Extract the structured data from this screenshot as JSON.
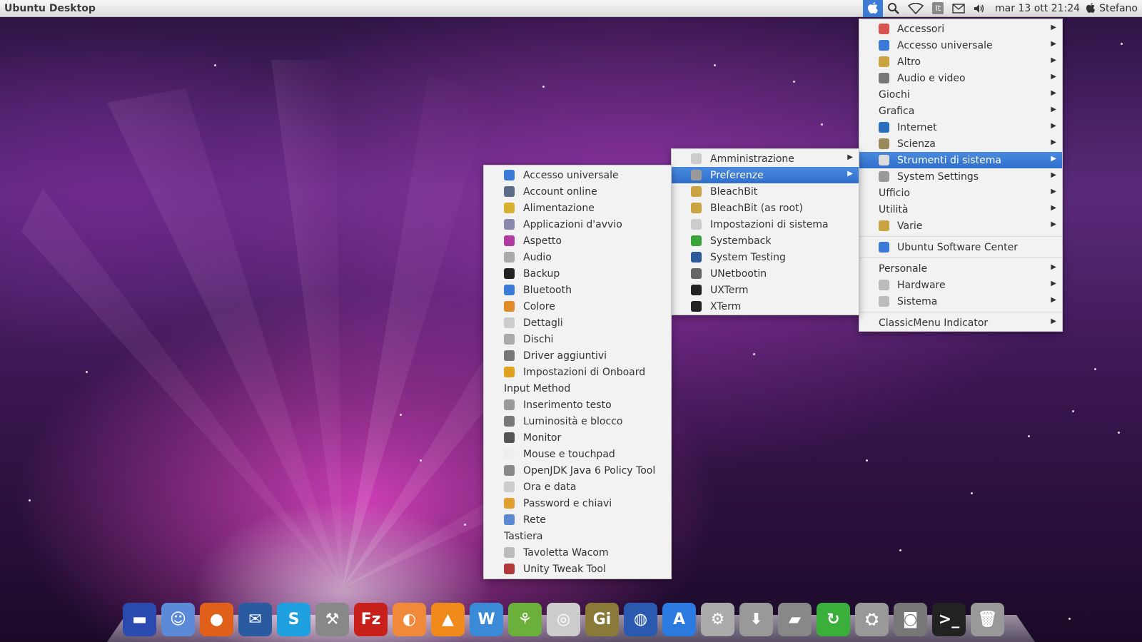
{
  "panel": {
    "title": "Ubuntu Desktop",
    "clock": "mar 13 ott 21:24",
    "user": "Stefano",
    "keyboard_layout": "It",
    "active_color": "#3d7cd4"
  },
  "main_menu": {
    "items": [
      {
        "label": "Accessori",
        "icon": "accessories-icon",
        "color": "#d9534f",
        "submenu": true
      },
      {
        "label": "Accesso universale",
        "icon": "accessibility-icon",
        "color": "#3b7ad8",
        "submenu": true
      },
      {
        "label": "Altro",
        "icon": "other-folder-icon",
        "color": "#c9a441",
        "submenu": true
      },
      {
        "label": "Audio e video",
        "icon": "multimedia-icon",
        "color": "#777777",
        "submenu": true
      },
      {
        "label": "Giochi",
        "icon": "",
        "submenu": true
      },
      {
        "label": "Grafica",
        "icon": "",
        "submenu": true
      },
      {
        "label": "Internet",
        "icon": "globe-icon",
        "color": "#2a6fbd",
        "submenu": true
      },
      {
        "label": "Scienza",
        "icon": "science-icon",
        "color": "#9a8a5a",
        "submenu": true
      },
      {
        "label": "Strumenti di sistema",
        "icon": "gear-icon",
        "color": "#dddddd",
        "submenu": true,
        "selected": true
      },
      {
        "label": "System Settings",
        "icon": "settings-icon",
        "color": "#999999",
        "submenu": true
      },
      {
        "label": "Ufficio",
        "icon": "",
        "submenu": true
      },
      {
        "label": "Utilità",
        "icon": "",
        "submenu": true
      },
      {
        "label": "Varie",
        "icon": "misc-folder-icon",
        "color": "#c9a441",
        "submenu": true
      }
    ],
    "software_center": {
      "label": "Ubuntu Software Center",
      "icon": "software-center-icon",
      "color": "#3b7ad8"
    },
    "places": [
      {
        "label": "Personale",
        "icon": "",
        "submenu": true
      },
      {
        "label": "Hardware",
        "icon": "hardware-icon",
        "color": "#bbbbbb",
        "submenu": true
      },
      {
        "label": "Sistema",
        "icon": "system-icon",
        "color": "#bbbbbb",
        "submenu": true
      }
    ],
    "classicmenu": {
      "label": "ClassicMenu Indicator",
      "submenu": true
    }
  },
  "strumenti_menu": {
    "items": [
      {
        "label": "Amministrazione",
        "icon": "admin-icon",
        "color": "#cccccc",
        "submenu": true
      },
      {
        "label": "Preferenze",
        "icon": "preferences-icon",
        "color": "#999999",
        "submenu": true,
        "selected": true
      },
      {
        "label": "BleachBit",
        "icon": "bleachbit-icon",
        "color": "#c9a441"
      },
      {
        "label": "BleachBit (as root)",
        "icon": "bleachbit-root-icon",
        "color": "#c9a441"
      },
      {
        "label": "Impostazioni di sistema",
        "icon": "system-settings-icon",
        "color": "#cccccc"
      },
      {
        "label": "Systemback",
        "icon": "systemback-icon",
        "color": "#3aa33a"
      },
      {
        "label": "System Testing",
        "icon": "system-testing-icon",
        "color": "#2c5b9c"
      },
      {
        "label": "UNetbootin",
        "icon": "unetbootin-icon",
        "color": "#666666"
      },
      {
        "label": "UXTerm",
        "icon": "terminal-icon",
        "color": "#222222"
      },
      {
        "label": "XTerm",
        "icon": "xterm-icon",
        "color": "#222222"
      }
    ]
  },
  "preferenze_menu": {
    "items": [
      {
        "label": "Accesso universale",
        "icon": "accessibility-icon",
        "color": "#3b7ad8"
      },
      {
        "label": "Account online",
        "icon": "online-accounts-icon",
        "color": "#5a6c86"
      },
      {
        "label": "Alimentazione",
        "icon": "power-icon",
        "color": "#d8b030"
      },
      {
        "label": "Applicazioni d'avvio",
        "icon": "startup-apps-icon",
        "color": "#8888aa"
      },
      {
        "label": "Aspetto",
        "icon": "appearance-icon",
        "color": "#b03aa0"
      },
      {
        "label": "Audio",
        "icon": "audio-icon",
        "color": "#aaaaaa"
      },
      {
        "label": "Backup",
        "icon": "backup-icon",
        "color": "#222222"
      },
      {
        "label": "Bluetooth",
        "icon": "bluetooth-icon",
        "color": "#3b7ad8"
      },
      {
        "label": "Colore",
        "icon": "color-icon",
        "color": "#e08a2a"
      },
      {
        "label": "Dettagli",
        "icon": "details-icon",
        "color": "#cccccc"
      },
      {
        "label": "Dischi",
        "icon": "disks-icon",
        "color": "#aaaaaa"
      },
      {
        "label": "Driver aggiuntivi",
        "icon": "drivers-icon",
        "color": "#777777"
      },
      {
        "label": "Impostazioni di Onboard",
        "icon": "onboard-icon",
        "color": "#e0a020"
      },
      {
        "label": "Input Method",
        "icon": ""
      },
      {
        "label": "Inserimento testo",
        "icon": "text-entry-icon",
        "color": "#999999"
      },
      {
        "label": "Luminosità e blocco",
        "icon": "brightness-icon",
        "color": "#777777"
      },
      {
        "label": "Monitor",
        "icon": "monitor-icon",
        "color": "#555555"
      },
      {
        "label": "Mouse e touchpad",
        "icon": "mouse-icon",
        "color": "#eeeeee"
      },
      {
        "label": "OpenJDK Java 6 Policy Tool",
        "icon": "java-icon",
        "color": "#888888"
      },
      {
        "label": "Ora e data",
        "icon": "clock-icon",
        "color": "#cccccc"
      },
      {
        "label": "Password e chiavi",
        "icon": "keys-icon",
        "color": "#e0a030"
      },
      {
        "label": "Rete",
        "icon": "network-icon",
        "color": "#5a8ad0"
      },
      {
        "label": "Tastiera",
        "icon": ""
      },
      {
        "label": "Tavoletta Wacom",
        "icon": "wacom-icon",
        "color": "#bbbbbb"
      },
      {
        "label": "Unity Tweak Tool",
        "icon": "unity-tweak-icon",
        "color": "#b03a3a"
      }
    ]
  },
  "dock": {
    "icons": [
      {
        "name": "launcher-icon",
        "color": "#2a4ab0",
        "glyph": "▬"
      },
      {
        "name": "finder-icon",
        "color": "#5a8ad8",
        "glyph": "☺"
      },
      {
        "name": "firefox-icon",
        "color": "#e0601a",
        "glyph": "●"
      },
      {
        "name": "thunderbird-icon",
        "color": "#2a5aa0",
        "glyph": "✉"
      },
      {
        "name": "skype-icon",
        "color": "#1ea0e0",
        "glyph": "S"
      },
      {
        "name": "tool-icon",
        "color": "#888888",
        "glyph": "⚒"
      },
      {
        "name": "filezilla-icon",
        "color": "#c8201a",
        "glyph": "Fz"
      },
      {
        "name": "orange-icon",
        "color": "#f08a3a",
        "glyph": "◐"
      },
      {
        "name": "vlc-icon",
        "color": "#f08a1a",
        "glyph": "▲"
      },
      {
        "name": "writer-icon",
        "color": "#3a8ad8",
        "glyph": "W"
      },
      {
        "name": "network-manager-icon",
        "color": "#6ab03a",
        "glyph": "⚘"
      },
      {
        "name": "disc-icon",
        "color": "#cccccc",
        "glyph": "◎"
      },
      {
        "name": "gimp-icon",
        "color": "#8a7a3a",
        "glyph": "Gi"
      },
      {
        "name": "sync-icon",
        "color": "#2a5ab0",
        "glyph": "◍"
      },
      {
        "name": "app-store-icon",
        "color": "#2a7ae0",
        "glyph": "A"
      },
      {
        "name": "settings-gear-icon",
        "color": "#aaaaaa",
        "glyph": "⚙"
      },
      {
        "name": "download-icon",
        "color": "#999999",
        "glyph": "⬇"
      },
      {
        "name": "usb-icon",
        "color": "#888888",
        "glyph": "▰"
      },
      {
        "name": "refresh-icon",
        "color": "#3ab03a",
        "glyph": "↻"
      },
      {
        "name": "disk-utility-icon",
        "color": "#999999",
        "glyph": "⛭"
      },
      {
        "name": "camera-icon",
        "color": "#777777",
        "glyph": "◙"
      },
      {
        "name": "terminal-dock-icon",
        "color": "#222222",
        "glyph": ">_"
      },
      {
        "name": "trash-icon",
        "color": "#999999",
        "glyph": "🗑"
      }
    ]
  }
}
